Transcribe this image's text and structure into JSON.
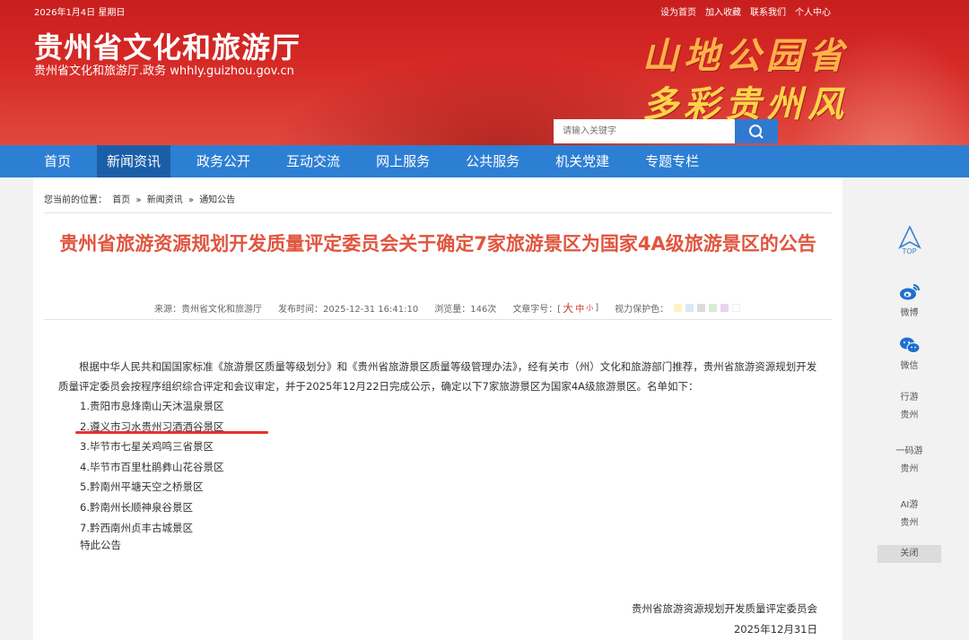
{
  "header": {
    "date": "2026年1月4日  星期日",
    "toplinks": [
      "设为首页",
      "加入收藏",
      "联系我们",
      "个人中心"
    ],
    "site_title": "贵州省文化和旅游厅",
    "site_subtitle": "贵州省文化和旅游厅.政务 whhly.guizhou.gov.cn",
    "slogan_line1": "山地公园省",
    "slogan_line2": "多彩贵州风",
    "search_placeholder": "请输入关键字"
  },
  "nav": {
    "items": [
      "首页",
      "新闻资讯",
      "政务公开",
      "互动交流",
      "网上服务",
      "公共服务",
      "机关党建",
      "专题专栏"
    ],
    "active_index": 1
  },
  "breadcrumb": {
    "prefix": "您当前的位置：",
    "items": [
      "首页",
      "»",
      "新闻资讯",
      "»",
      "通知公告"
    ]
  },
  "article": {
    "title": "贵州省旅游资源规划开发质量评定委员会关于确定7家旅游景区为国家4A级旅游景区的公告",
    "meta": {
      "source": "来源：贵州省文化和旅游厅",
      "publish_time": "发布时间：2025-12-31 16:41:10",
      "views": "浏览量：146次",
      "font_size_label": "文章字号：[",
      "font_big": "大",
      "font_mid": "中",
      "font_small": "小",
      "font_size_close": "]",
      "eye_care_label": "视力保护色："
    },
    "eye_care_colors": [
      "#fbf5c4",
      "#d9e8f5",
      "#dcdcdc",
      "#d6ecd6",
      "#e6d6f0",
      "#ffffff"
    ],
    "intro": "根据中华人民共和国国家标准《旅游景区质量等级划分》和《贵州省旅游景区质量等级管理办法》，经有关市（州）文化和旅游部门推荐，贵州省旅游资源规划开发质量评定委员会按程序组织综合评定和会议审定，并于2025年12月22日完成公示，确定以下7家旅游景区为国家4A级旅游景区。名单如下：",
    "list": [
      "1.贵阳市息烽南山天沐温泉景区",
      "2.遵义市习水贵州习酒酒谷景区",
      "3.毕节市七星关鸡鸣三省景区",
      "4.毕节市百里杜鹃彝山花谷景区",
      "5.黔南州平塘天空之桥景区",
      "6.黔南州长顺神泉谷景区",
      "7.黔西南州贞丰古城景区"
    ],
    "closing": "特此公告",
    "sign_org": "贵州省旅游资源规划开发质量评定委员会",
    "sign_date": "2025年12月31日"
  },
  "float_sidebar": {
    "top_label": "TOP",
    "weibo": "微博",
    "wechat": "微信",
    "item3_line1": "行游",
    "item3_line2": "贵州",
    "item4_line1": "一码游",
    "item4_line2": "贵州",
    "item5_line1": "AI游",
    "item5_line2": "贵州",
    "close": "关闭"
  },
  "colors": {
    "header_red": "#d62a27",
    "nav_blue": "#2d7fd3",
    "nav_active": "#1b5ea8",
    "title_red": "#e0553f",
    "highlight_underline": "#e6332a"
  }
}
